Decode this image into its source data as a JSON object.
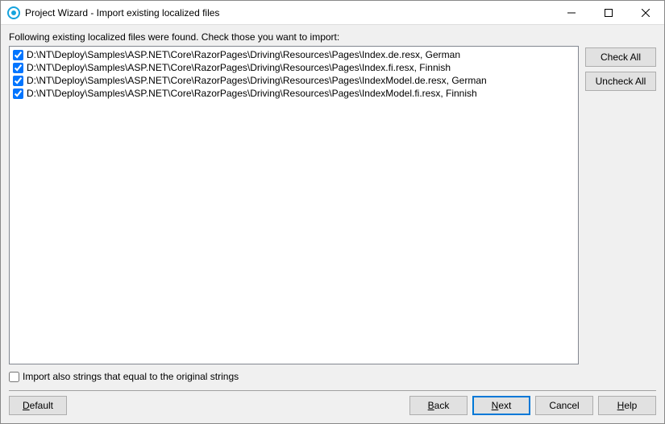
{
  "window": {
    "title": "Project Wizard - Import existing localized files"
  },
  "instruction": "Following existing localized files were found. Check those you want to import:",
  "files": [
    {
      "checked": true,
      "path": "D:\\NT\\Deploy\\Samples\\ASP.NET\\Core\\RazorPages\\Driving\\Resources\\Pages\\Index.de.resx, German"
    },
    {
      "checked": true,
      "path": "D:\\NT\\Deploy\\Samples\\ASP.NET\\Core\\RazorPages\\Driving\\Resources\\Pages\\Index.fi.resx, Finnish"
    },
    {
      "checked": true,
      "path": "D:\\NT\\Deploy\\Samples\\ASP.NET\\Core\\RazorPages\\Driving\\Resources\\Pages\\IndexModel.de.resx, German"
    },
    {
      "checked": true,
      "path": "D:\\NT\\Deploy\\Samples\\ASP.NET\\Core\\RazorPages\\Driving\\Resources\\Pages\\IndexModel.fi.resx, Finnish"
    }
  ],
  "side": {
    "check_all": "Check All",
    "uncheck_all": "Uncheck All"
  },
  "option": {
    "import_equal": "Import also strings that equal to the original strings",
    "checked": false
  },
  "footer": {
    "default": "Default",
    "back": "Back",
    "next": "Next",
    "cancel": "Cancel",
    "help": "Help"
  }
}
